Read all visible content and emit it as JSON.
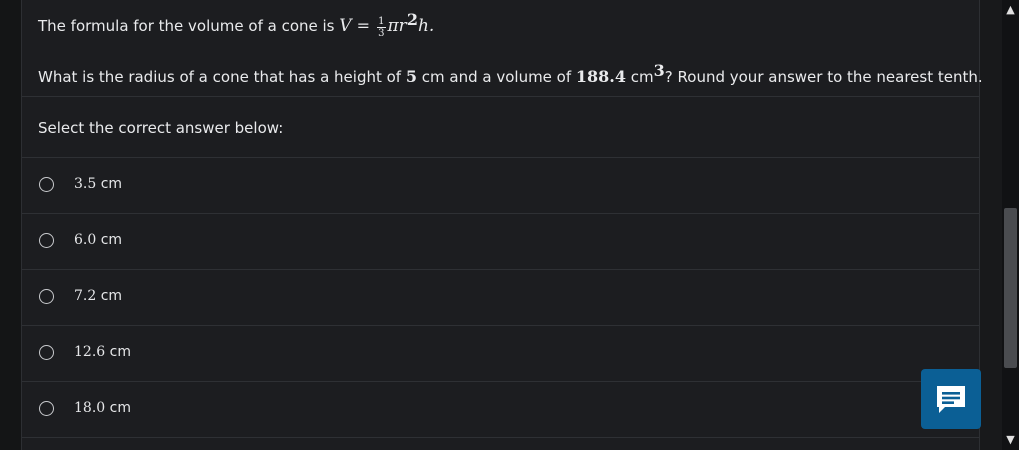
{
  "question": {
    "formula_prefix": "The formula for the volume of a cone is ",
    "formula_V": "V",
    "formula_eq": " = ",
    "frac_num": "1",
    "frac_den": "3",
    "formula_rest": "πr",
    "formula_exp": "2",
    "formula_h": "h.",
    "ask_part1": "What is the radius of a cone that has a height of ",
    "height_value": "5",
    "ask_part2": " cm and a volume of ",
    "volume_value": "188.4",
    "volume_unit": " cm",
    "volume_exp": "3",
    "ask_part3": "? Round your answer to the nearest tenth."
  },
  "prompt": "Select the correct answer below:",
  "options": [
    {
      "value": "3.5",
      "unit": " cm"
    },
    {
      "value": "6.0",
      "unit": " cm"
    },
    {
      "value": "7.2",
      "unit": " cm"
    },
    {
      "value": "12.6",
      "unit": " cm"
    },
    {
      "value": "18.0",
      "unit": " cm"
    }
  ],
  "colors": {
    "accent": "#0b5f95",
    "background": "#1c1d20"
  },
  "icons": {
    "chat": "chat-bubble-icon",
    "scroll_up": "chevron-up-icon",
    "scroll_down": "chevron-down-icon"
  }
}
